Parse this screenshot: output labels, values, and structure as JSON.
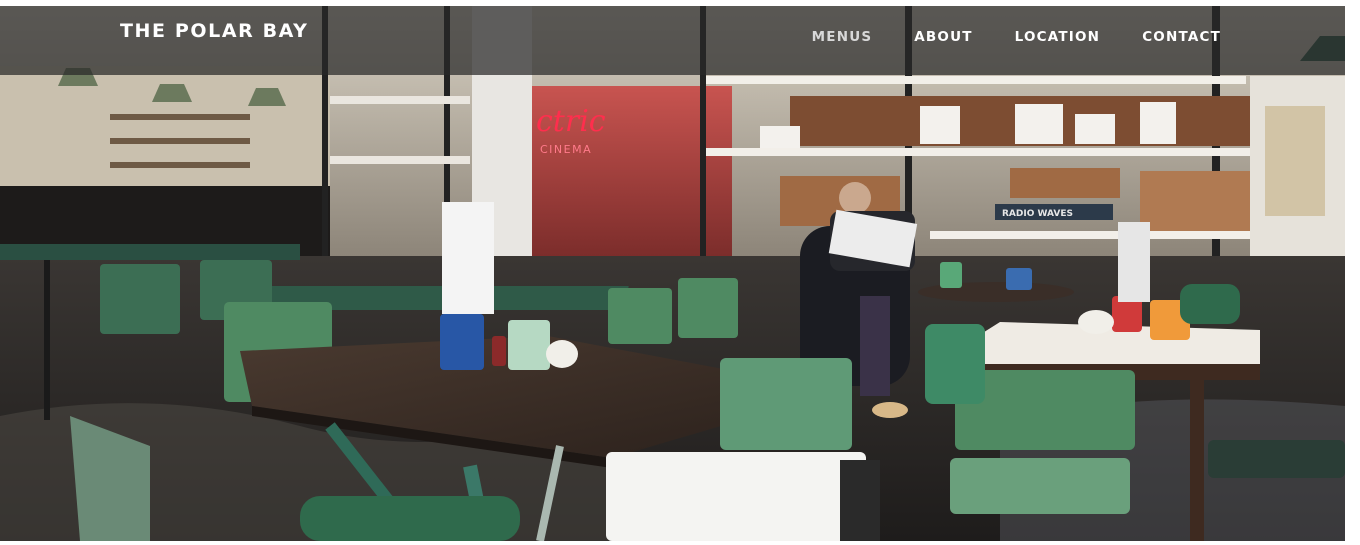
{
  "brand": {
    "name": "THE POLAR BAY"
  },
  "nav": {
    "items": [
      {
        "label": "MENUS",
        "active": true
      },
      {
        "label": "ABOUT",
        "active": false
      },
      {
        "label": "LOCATION",
        "active": false
      },
      {
        "label": "CONTACT",
        "active": false
      }
    ]
  },
  "hero": {
    "neon_sign": {
      "line1": "ctric",
      "line2": "CINEMA"
    },
    "shelf_box_label": "RADIO WAVES",
    "colors": {
      "neon": "#ff2e4d",
      "navbar_bg": "#282828",
      "table_green": "#2f5a48",
      "chair_green": "#4f8a62"
    }
  }
}
